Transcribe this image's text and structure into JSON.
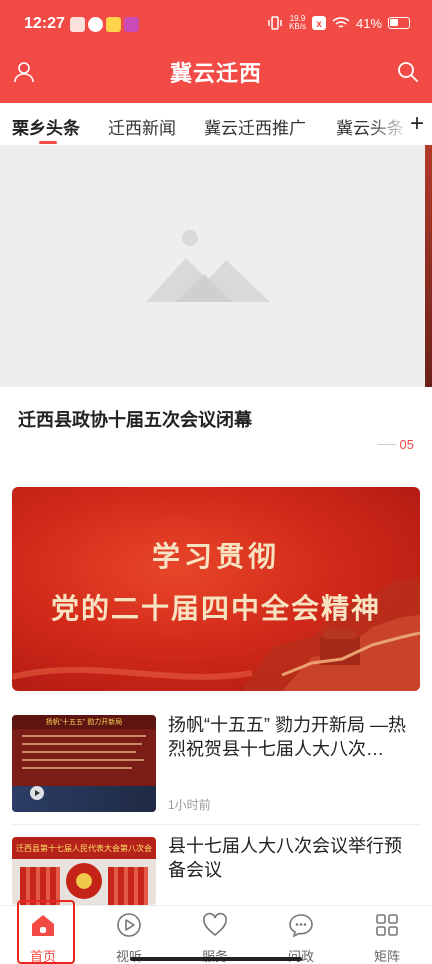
{
  "status_bar": {
    "time": "12:27",
    "net_speed_value": "19.9",
    "net_speed_unit": "KB/s",
    "signal": "5G",
    "battery": "41%"
  },
  "header": {
    "title": "冀云迁西",
    "user_icon": "user-icon",
    "search_icon": "search-icon"
  },
  "tabs": {
    "items": [
      "栗乡头条",
      "迁西新闻",
      "冀云迁西推广",
      "冀云头条"
    ],
    "active_index": 0,
    "add_label": "+"
  },
  "carousel": {
    "title": "迁西县政协十届五次会议闭幕",
    "page_indicator": "05"
  },
  "promo": {
    "line1": "学习贯彻",
    "line2": "党的二十届四中全会精神"
  },
  "news": [
    {
      "title": "扬帆“十五五” 勠力开新局 —热烈祝贺县十七届人大八次…",
      "time": "1小时前",
      "thumb_heading": "扬帆“十五五” 勠力开新局"
    },
    {
      "title": "县十七届人大八次会议举行预备会议",
      "thumb_heading": "迁西县第十七届人民代表大会第八次会议"
    }
  ],
  "bottom_nav": {
    "items": [
      "首页",
      "视听",
      "服务",
      "问政",
      "矩阵"
    ],
    "active_index": 0
  },
  "colors": {
    "brand": "#f24a44",
    "highlight_box": "#e8281e"
  }
}
